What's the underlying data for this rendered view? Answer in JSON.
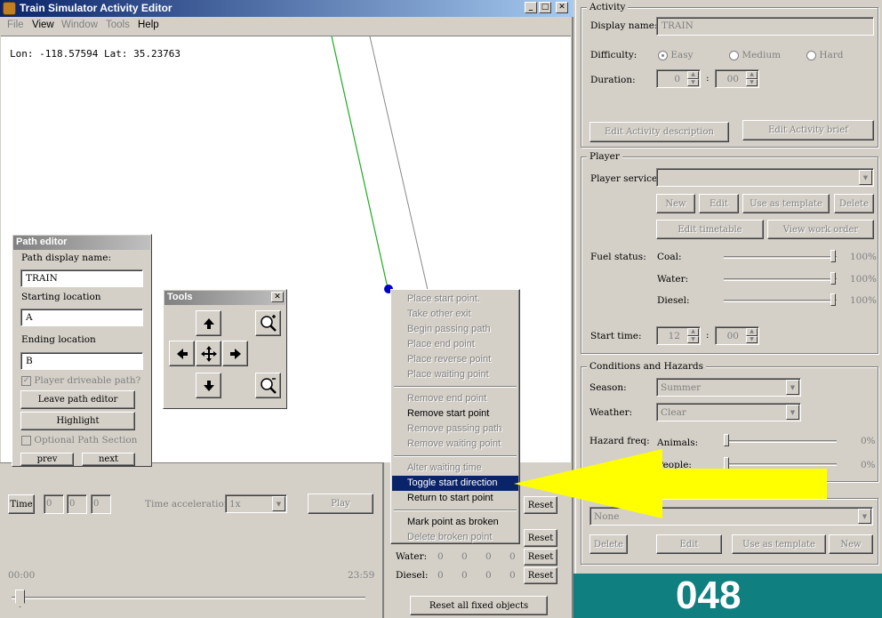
{
  "window": {
    "title": "Train Simulator Activity Editor",
    "minimize": "_",
    "maximize": "□",
    "close": "✕"
  },
  "menubar": [
    {
      "label": "File",
      "enabled": false
    },
    {
      "label": "View",
      "enabled": true
    },
    {
      "label": "Window",
      "enabled": false
    },
    {
      "label": "Tools",
      "enabled": false
    },
    {
      "label": "Help",
      "enabled": true
    }
  ],
  "map": {
    "coords": "Lon: -118.57594 Lat: 35.23763",
    "track_color": "#22aa22",
    "point_color": "#0000cc"
  },
  "path_editor": {
    "title": "Path editor",
    "display_name_label": "Path display name:",
    "display_name_value": "TRAIN",
    "start_label": "Starting location",
    "start_value": "A",
    "end_label": "Ending location",
    "end_value": "B",
    "player_driveable": "Player driveable path?",
    "leave_button": "Leave path editor",
    "highlight_button": "Highlight",
    "optional_section": "Optional Path Section",
    "prev_button": "prev",
    "next_button": "next"
  },
  "tools": {
    "title": "Tools",
    "close": "✕"
  },
  "context_menu": {
    "group1": [
      "Place start point.",
      "Take other exit",
      "Begin passing path",
      "Place end point",
      "Place reverse point",
      "Place waiting point"
    ],
    "group2": [
      "Remove end point",
      "Remove start point",
      "Remove passing path",
      "Remove waiting point"
    ],
    "group3": [
      "Alter waiting time",
      "Toggle start direction",
      "Return to start point"
    ],
    "group4": [
      "Mark point as broken",
      "Delete broken point"
    ]
  },
  "bottom": {
    "time_label": "Time",
    "time_values": [
      "0",
      "0",
      "0"
    ],
    "accel_label": "Time acceleration",
    "accel_value": "1x",
    "play_button": "Play",
    "slider_start": "00:00",
    "slider_end": "23:59",
    "slider_value": 0
  },
  "fuel_grid": {
    "water_label": "Water:",
    "diesel_label": "Diesel:",
    "values": [
      "0",
      "0",
      "0",
      "0"
    ],
    "reset_button": "Reset",
    "reset_all_button": "Reset all fixed objects"
  },
  "activity": {
    "legend": "Activity",
    "display_name_label": "Display name:",
    "display_name_value": "TRAIN",
    "difficulty_label": "Difficulty:",
    "difficulties": [
      "Easy",
      "Medium",
      "Hard"
    ],
    "difficulty_selected": "Easy",
    "duration_label": "Duration:",
    "duration_hours": "0",
    "duration_minutes": "00",
    "edit_description": "Edit Activity description",
    "edit_brief": "Edit Activity brief"
  },
  "player": {
    "legend": "Player",
    "service_label": "Player service:",
    "service_value": "",
    "new_button": "New",
    "edit_button": "Edit",
    "use_template_button": "Use as template",
    "delete_button": "Delete",
    "edit_timetable": "Edit timetable",
    "view_work_order": "View work order",
    "fuel_label": "Fuel status:",
    "coal_label": "Coal:",
    "coal_value": "100%",
    "coal_level": 100,
    "water_label": "Water:",
    "water_value": "100%",
    "water_level": 100,
    "diesel_label": "Diesel:",
    "diesel_value": "100%",
    "diesel_level": 100,
    "start_time_label": "Start time:",
    "start_hours": "12",
    "start_minutes": "00"
  },
  "conditions": {
    "legend": "Conditions and Hazards",
    "season_label": "Season:",
    "season_value": "Summer",
    "weather_label": "Weather:",
    "weather_value": "Clear",
    "hazard_label": "Hazard freq:",
    "animals_label": "Animals:",
    "animals_value": "0%",
    "animals_level": 0,
    "people_label": "People:",
    "people_value": "0%",
    "people_level": 0
  },
  "traffic": {
    "select_value": "None",
    "delete_button": "Delete",
    "edit_button": "Edit",
    "use_template_button": "Use as template",
    "new_button": "New"
  },
  "badge": {
    "number": "048",
    "color": "#0f7f7f"
  },
  "arrow": {
    "color": "#ffff00"
  }
}
